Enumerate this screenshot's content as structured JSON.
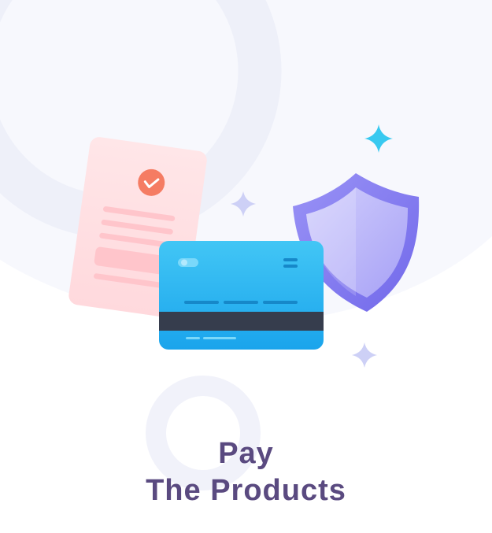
{
  "screen": {
    "title_line1": "Pay",
    "title_line2": "The Products"
  },
  "illustration": {
    "receipt_icon": "receipt-icon",
    "check_icon": "check-icon",
    "card_icon": "credit-card-icon",
    "shield_icon": "shield-icon",
    "sparkle_icon": "sparkle-icon"
  },
  "colors": {
    "title": "#5a4a80",
    "background_shape": "#f3f4fb",
    "card_top": "#3ec2f4",
    "card_bottom": "#1ea6ec",
    "card_stripe": "#363d4d",
    "shield_outer": "#8a82f2",
    "shield_inner": "#c0bcfa",
    "receipt": "#ffe4e6",
    "check_badge": "#f57c63",
    "sparkle_cyan": "#38c9f0",
    "sparkle_lilac": "#c9cbf5"
  }
}
